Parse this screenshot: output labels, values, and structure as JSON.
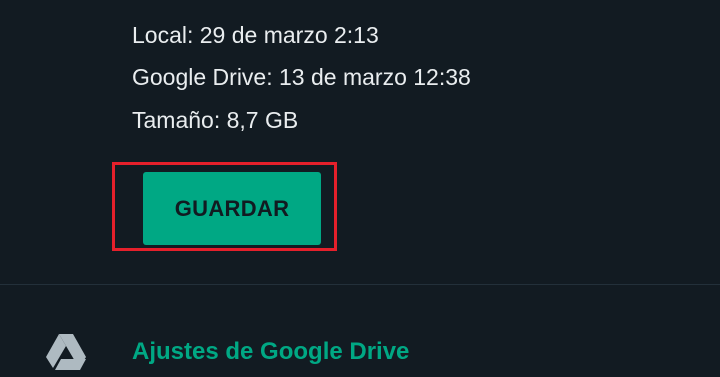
{
  "backup_info": {
    "local": "Local: 29 de marzo 2:13",
    "google_drive": "Google Drive: 13 de marzo 12:38",
    "size": "Tamaño: 8,7 GB"
  },
  "actions": {
    "save_label": "GUARDAR"
  },
  "settings": {
    "drive_label": "Ajustes de Google Drive",
    "drive_icon": "google-drive-icon"
  },
  "colors": {
    "background": "#121b22",
    "text": "#e9edef",
    "accent": "#00a884",
    "highlight": "#e5202b",
    "icon": "#aebac1"
  }
}
